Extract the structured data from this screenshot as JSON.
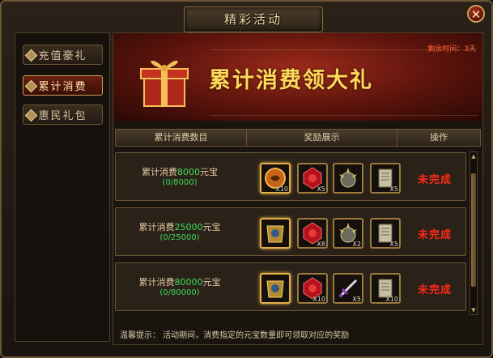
{
  "window": {
    "title": "精彩活动",
    "close_label": "✕"
  },
  "nav": {
    "items": [
      {
        "label": "充值豪礼",
        "active": false
      },
      {
        "label": "累计消费",
        "active": true
      },
      {
        "label": "惠民礼包",
        "active": false
      }
    ]
  },
  "banner": {
    "title": "累计消费领大礼",
    "remaining": "剩余时间：3天"
  },
  "table": {
    "headers": [
      "累计消费数目",
      "奖励展示",
      "操作"
    ],
    "rows": [
      {
        "prefix": "累计消费",
        "amount": "8000",
        "suffix": "元宝",
        "progress": "(0/8000)",
        "rewards": [
          {
            "icon": "amber-orb-icon",
            "qty": "X10",
            "gold": true
          },
          {
            "icon": "red-gem-icon",
            "qty": "X5",
            "gold": false
          },
          {
            "icon": "spiked-orb-icon",
            "qty": "",
            "gold": false
          },
          {
            "icon": "scroll-icon",
            "qty": "X5",
            "gold": false
          }
        ],
        "status": "未完成"
      },
      {
        "prefix": "累计消费",
        "amount": "25000",
        "suffix": "元宝",
        "progress": "(0/25000)",
        "rewards": [
          {
            "icon": "golden-armor-icon",
            "qty": "",
            "gold": true
          },
          {
            "icon": "red-gem-icon",
            "qty": "X8",
            "gold": false
          },
          {
            "icon": "spiked-orb-icon",
            "qty": "X2",
            "gold": false
          },
          {
            "icon": "scroll-icon",
            "qty": "X5",
            "gold": false
          }
        ],
        "status": "未完成"
      },
      {
        "prefix": "累计消费",
        "amount": "80000",
        "suffix": "元宝",
        "progress": "(0/80000)",
        "rewards": [
          {
            "icon": "golden-armor-icon",
            "qty": "",
            "gold": true
          },
          {
            "icon": "red-gem-icon",
            "qty": "X10",
            "gold": false
          },
          {
            "icon": "sword-icon",
            "qty": "X5",
            "gold": false
          },
          {
            "icon": "scroll-icon",
            "qty": "X10",
            "gold": false
          }
        ],
        "status": "未完成"
      }
    ]
  },
  "hint": "温馨提示：  活动期间，消费指定的元宝数量即可领取对应的奖励",
  "colors": {
    "status_red": "#ff2a1a",
    "amount_green": "#3fdc58",
    "banner_gold": "#ffd75a"
  }
}
